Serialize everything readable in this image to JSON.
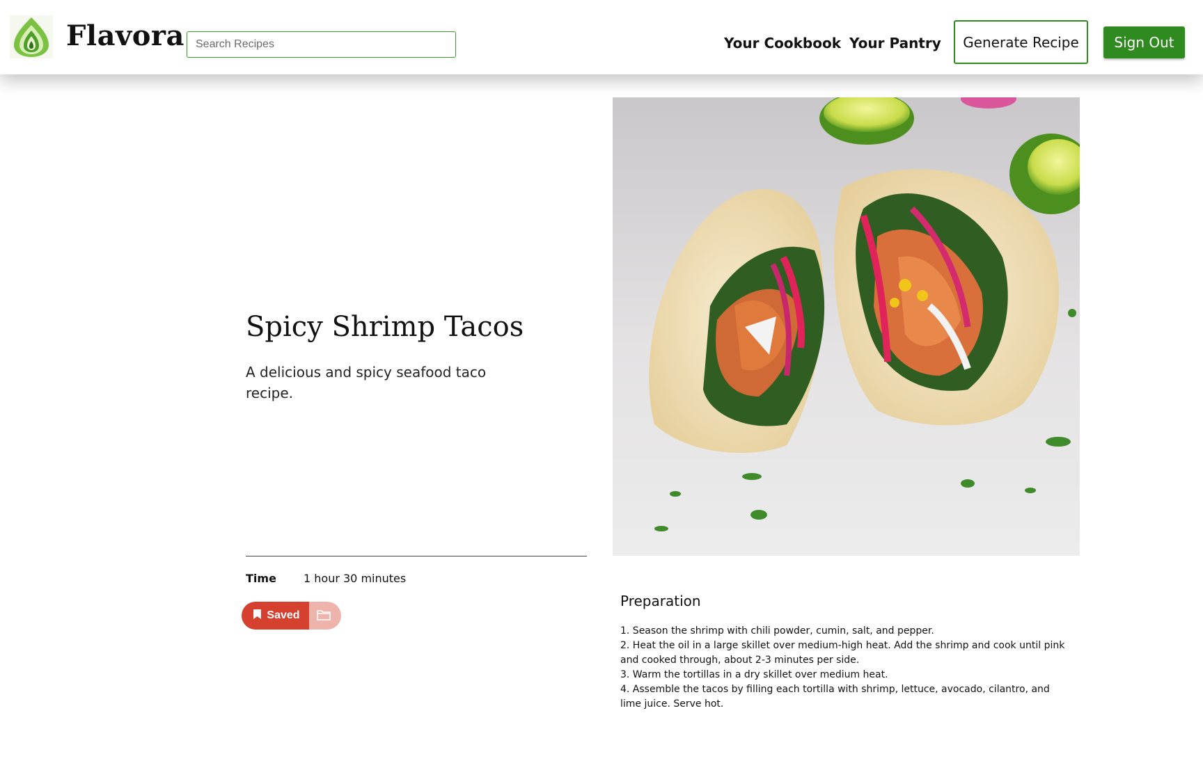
{
  "header": {
    "brand": "Flavora",
    "search_placeholder": "Search Recipes",
    "search_value": "",
    "nav": {
      "cookbook": "Your Cookbook",
      "pantry": "Your Pantry"
    },
    "generate_label": "Generate Recipe",
    "signout_label": "Sign Out"
  },
  "recipe": {
    "title": "Spicy Shrimp Tacos",
    "description": "A delicious and spicy seafood taco recipe.",
    "time_label": "Time",
    "time_value": "1 hour 30 minutes",
    "saved_label": "Saved",
    "image_subject": "shrimp tacos with limes",
    "preparation_heading": "Preparation",
    "steps": [
      "1. Season the shrimp with chili powder, cumin, salt, and pepper.",
      "2. Heat the oil in a large skillet over medium-high heat. Add the shrimp and cook until pink and cooked through, about 2-3 minutes per side.",
      "3. Warm the tortillas in a dry skillet over medium heat.",
      "4. Assemble the tacos by filling each tortilla with shrimp, lettuce, avocado, cilantro, and lime juice. Serve hot."
    ]
  },
  "icons": {
    "logo": "leaf-logo-icon",
    "bookmark": "bookmark-icon",
    "folder": "folder-icon"
  },
  "colors": {
    "brand_green": "#2f8a1f",
    "saved_red": "#d6402e",
    "folder_pink": "#eeb3ab"
  }
}
